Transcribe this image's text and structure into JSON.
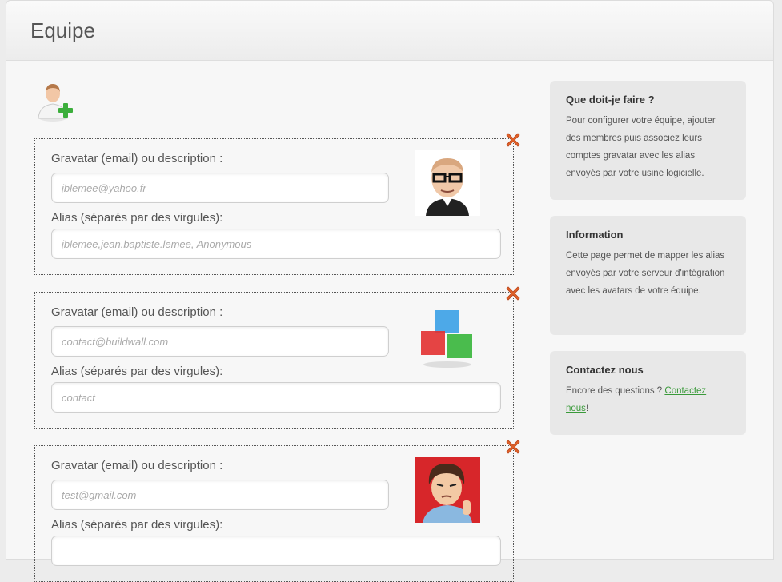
{
  "page": {
    "title": "Equipe"
  },
  "members": [
    {
      "email_label": "Gravatar (email) ou description :",
      "email_placeholder": "jblemee@yahoo.fr",
      "alias_label": "Alias (séparés par des virgules):",
      "alias_placeholder": "jblemee,jean.baptiste.lemee, Anonymous"
    },
    {
      "email_label": "Gravatar (email) ou description :",
      "email_placeholder": "contact@buildwall.com",
      "alias_label": "Alias (séparés par des virgules):",
      "alias_placeholder": "contact"
    },
    {
      "email_label": "Gravatar (email) ou description :",
      "email_placeholder": "test@gmail.com",
      "alias_label": "Alias (séparés par des virgules):",
      "alias_placeholder": ""
    }
  ],
  "sidebar": {
    "help": {
      "title": "Que doit-je faire ?",
      "text": "Pour configurer votre équipe, ajouter des membres puis associez leurs comptes gravatar avec les alias envoyés par votre usine logicielle."
    },
    "info": {
      "title": "Information",
      "text": "Cette page permet de mapper les alias envoyés par votre serveur d'intégration avec les avatars de votre équipe."
    },
    "contact": {
      "title": "Contactez nous",
      "text_before": "Encore des questions ? ",
      "link": "Contactez nous",
      "text_after": "!"
    }
  },
  "icons": {
    "add_user": "add-user-icon",
    "remove": "remove-icon",
    "accent_remove": "#e0622a",
    "accent_add": "#3cae3c"
  }
}
